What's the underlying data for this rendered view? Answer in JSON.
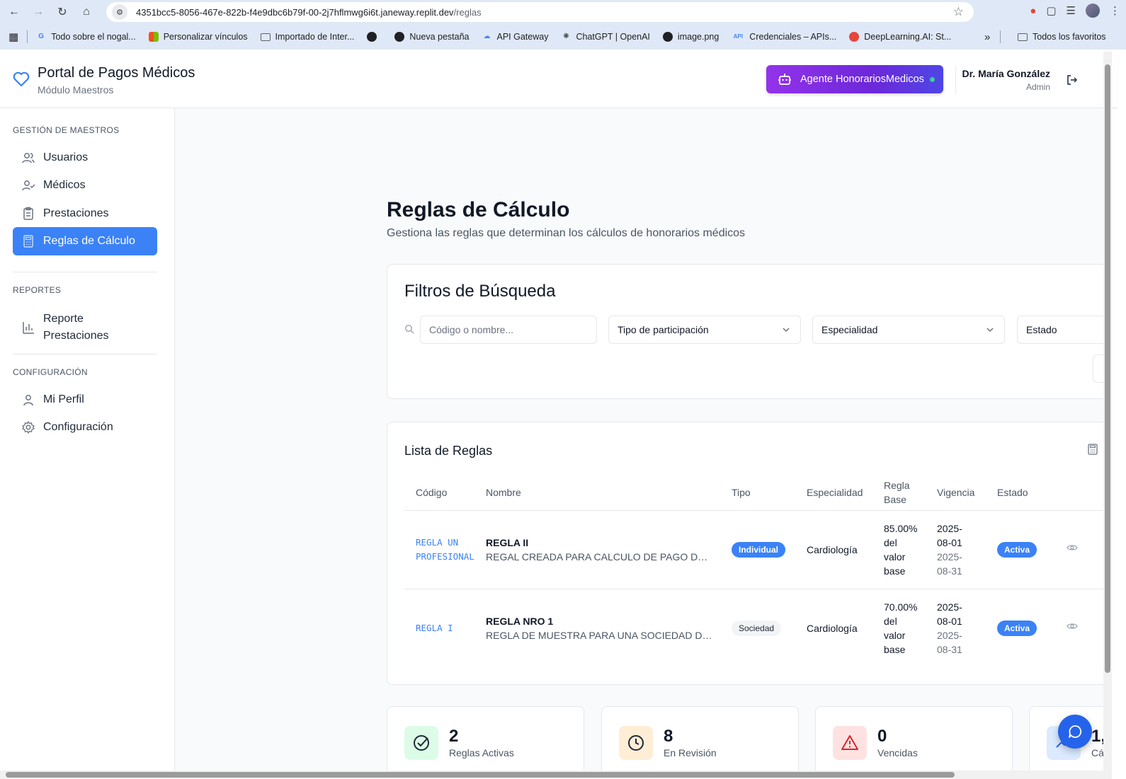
{
  "browser": {
    "url_host": "4351bcc5-8056-467e-822b-f4e9dbc6b79f-00-2j7hflmwg6i6t.janeway.replit.dev",
    "url_path": "/reglas",
    "bookmarks": [
      {
        "label": "Todo sobre el nogal...",
        "icon": "google-icon"
      },
      {
        "label": "Personalizar vínculos",
        "icon": "microsoft-icon"
      },
      {
        "label": "Importado de Inter...",
        "icon": "folder-icon"
      },
      {
        "label": "",
        "icon": "globe-icon"
      },
      {
        "label": "Nueva pestaña",
        "icon": "globe-icon"
      },
      {
        "label": "API Gateway",
        "icon": "cloud-icon"
      },
      {
        "label": "ChatGPT | OpenAI",
        "icon": "openai-icon"
      },
      {
        "label": "image.png",
        "icon": "globe-icon"
      },
      {
        "label": "Credenciales – APIs...",
        "icon": "api-icon"
      },
      {
        "label": "DeepLearning.AI: St...",
        "icon": "deeplearning-icon"
      }
    ],
    "all_bookmarks_label": "Todos los favoritos"
  },
  "header": {
    "title": "Portal de Pagos Médicos",
    "subtitle": "Módulo Maestros",
    "agent_button": "Agente HonorariosMedicos",
    "user_name": "Dr. María González",
    "user_role": "Admin"
  },
  "sidebar": {
    "sections": [
      {
        "title": "GESTIÓN DE MAESTROS",
        "items": [
          "Usuarios",
          "Médicos",
          "Prestaciones",
          "Reglas de Cálculo"
        ]
      },
      {
        "title": "REPORTES",
        "items": [
          "Reporte Prestaciones"
        ]
      },
      {
        "title": "CONFIGURACIÓN",
        "items": [
          "Mi Perfil",
          "Configuración"
        ]
      }
    ],
    "active_item": "Reglas de Cálculo"
  },
  "page": {
    "title": "Reglas de Cálculo",
    "subtitle": "Gestiona las reglas que determinan los cálculos de honorarios médicos"
  },
  "filters": {
    "title": "Filtros de Búsqueda",
    "search_placeholder": "Código o nombre...",
    "tipo": "Tipo de participación",
    "especialidad": "Especialidad",
    "estado": "Estado"
  },
  "rules": {
    "title": "Lista de Reglas",
    "columns": [
      "Código",
      "Nombre",
      "Tipo",
      "Especialidad",
      "Regla Base",
      "Vigencia",
      "Estado"
    ],
    "rows": [
      {
        "code_l1": "REGLA UN",
        "code_l2": "PROFESIONAL",
        "name": "REGLA II",
        "desc": "REGAL CREADA PARA CALCULO DE PAGO DE UN ...",
        "tipo": "Individual",
        "especialidad": "Cardiología",
        "base_l1": "85.00%",
        "base_l2": "del",
        "base_l3": "valor",
        "base_l4": "base",
        "from_l1": "2025-",
        "from_l2": "08-01",
        "to_l1": "2025-",
        "to_l2": "08-31",
        "estado": "Activa"
      },
      {
        "code_l1": "REGLA I",
        "code_l2": "",
        "name": "REGLA NRO 1",
        "desc": "REGLA DE MUESTRA PARA UNA SOCIEDAD DE PR...",
        "tipo": "Sociedad",
        "especialidad": "Cardiología",
        "base_l1": "70.00%",
        "base_l2": "del",
        "base_l3": "valor",
        "base_l4": "base",
        "from_l1": "2025-",
        "from_l2": "08-01",
        "to_l1": "2025-",
        "to_l2": "08-31",
        "estado": "Activa"
      }
    ]
  },
  "stats": [
    {
      "value": "2",
      "label": "Reglas Activas",
      "color": "#16a34a",
      "bg": "#dcfce7",
      "icon": "check-circle-icon"
    },
    {
      "value": "8",
      "label": "En Revisión",
      "color": "#1f2937",
      "bg": "#ffedd5",
      "icon": "clock-icon"
    },
    {
      "value": "0",
      "label": "Vencidas",
      "color": "#dc2626",
      "bg": "#fee2e2",
      "icon": "alert-triangle-icon"
    },
    {
      "value": "1,",
      "label": "Cá",
      "color": "#2563eb",
      "bg": "#dbeafe",
      "icon": "trending-up-icon"
    }
  ],
  "colors": {
    "accent": "#3b82f6",
    "agent_gradient_start": "#9333ea",
    "agent_gradient_end": "#4f46e5"
  }
}
